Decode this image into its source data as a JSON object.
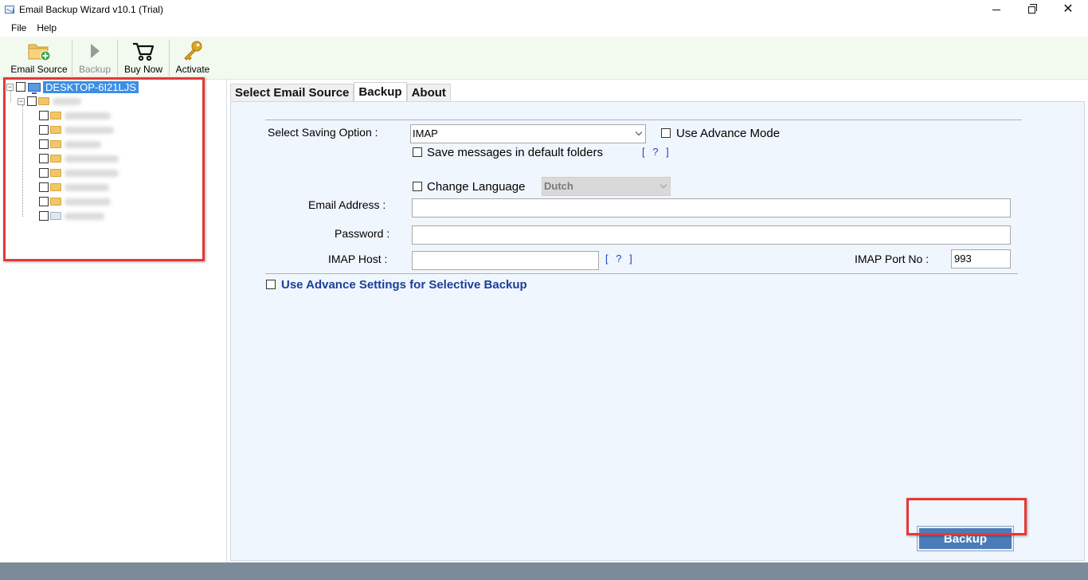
{
  "window": {
    "title": "Email Backup Wizard v10.1 (Trial)"
  },
  "menu": {
    "items": [
      "File",
      "Help"
    ]
  },
  "toolbar": {
    "email_source": "Email Source",
    "backup": "Backup",
    "buy_now": "Buy Now",
    "activate": "Activate"
  },
  "tree": {
    "root_label": "DESKTOP-6I21LJS",
    "child_count_blurred": 9
  },
  "tabs": [
    "Select Email Source",
    "Backup",
    "About"
  ],
  "backup_tab": {
    "saving_option_label": "Select Saving Option :",
    "saving_option_value": "IMAP",
    "advance_mode_label": "Use Advance Mode",
    "save_default_folders_label": "Save messages in default folders",
    "help_link": "[ ? ]",
    "change_language_label": "Change Language",
    "language_value": "Dutch",
    "email_address_label": "Email Address :",
    "email_address_value": "",
    "password_label": "Password :",
    "password_value": "",
    "imap_host_label": "IMAP Host :",
    "imap_host_value": "",
    "imap_port_label": "IMAP Port No :",
    "imap_port_value": "993",
    "advance_settings_label": "Use Advance Settings for Selective Backup",
    "backup_button_label": "Backup"
  },
  "colors": {
    "toolbar_bg": "#f2faf0",
    "panel_bg": "#f0f6fd",
    "accent_blue": "#4b7cb9",
    "link_blue": "#1b46c9",
    "highlight_red": "#e53935",
    "taskbar": "#7c8b9a"
  }
}
